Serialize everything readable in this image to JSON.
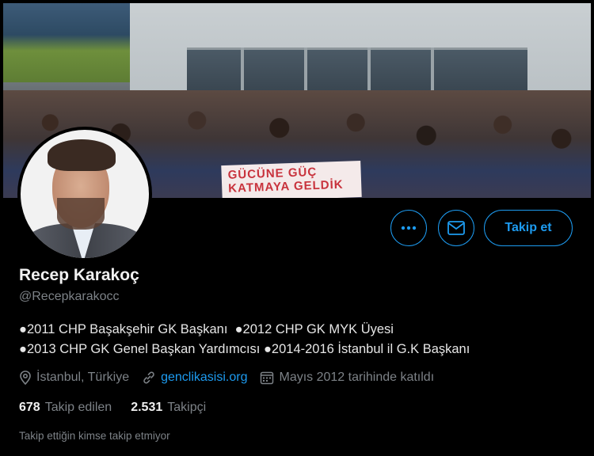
{
  "profile": {
    "name": "Recep Karakoç",
    "handle": "@Recepkarakocc",
    "bio_lines": [
      "●2011 CHP Başakşehir GK Başkanı  ●2012 CHP GK MYK Üyesi",
      "●2013 CHP GK Genel Başkan Yardımcısı ●2014-2016 İstanbul il G.K Başkanı"
    ],
    "location": "İstanbul, Türkiye",
    "website": "genclikasisi.org",
    "joined": "Mayıs 2012 tarihinde katıldı"
  },
  "banner": {
    "sign_text": [
      "GÜCÜNE GÜÇ",
      "KATMAYA GELDİK"
    ]
  },
  "stats": {
    "following_count": "678",
    "following_label": "Takip edilen",
    "followers_count": "2.531",
    "followers_label": "Takipçi"
  },
  "actions": {
    "more_icon": "ellipsis-icon",
    "message_icon": "envelope-icon",
    "follow_label": "Takip et"
  },
  "mutual_note": "Takip ettiğin kimse takip etmiyor",
  "colors": {
    "accent": "#1d9bf0",
    "background": "#000000",
    "muted": "#7d8287"
  }
}
